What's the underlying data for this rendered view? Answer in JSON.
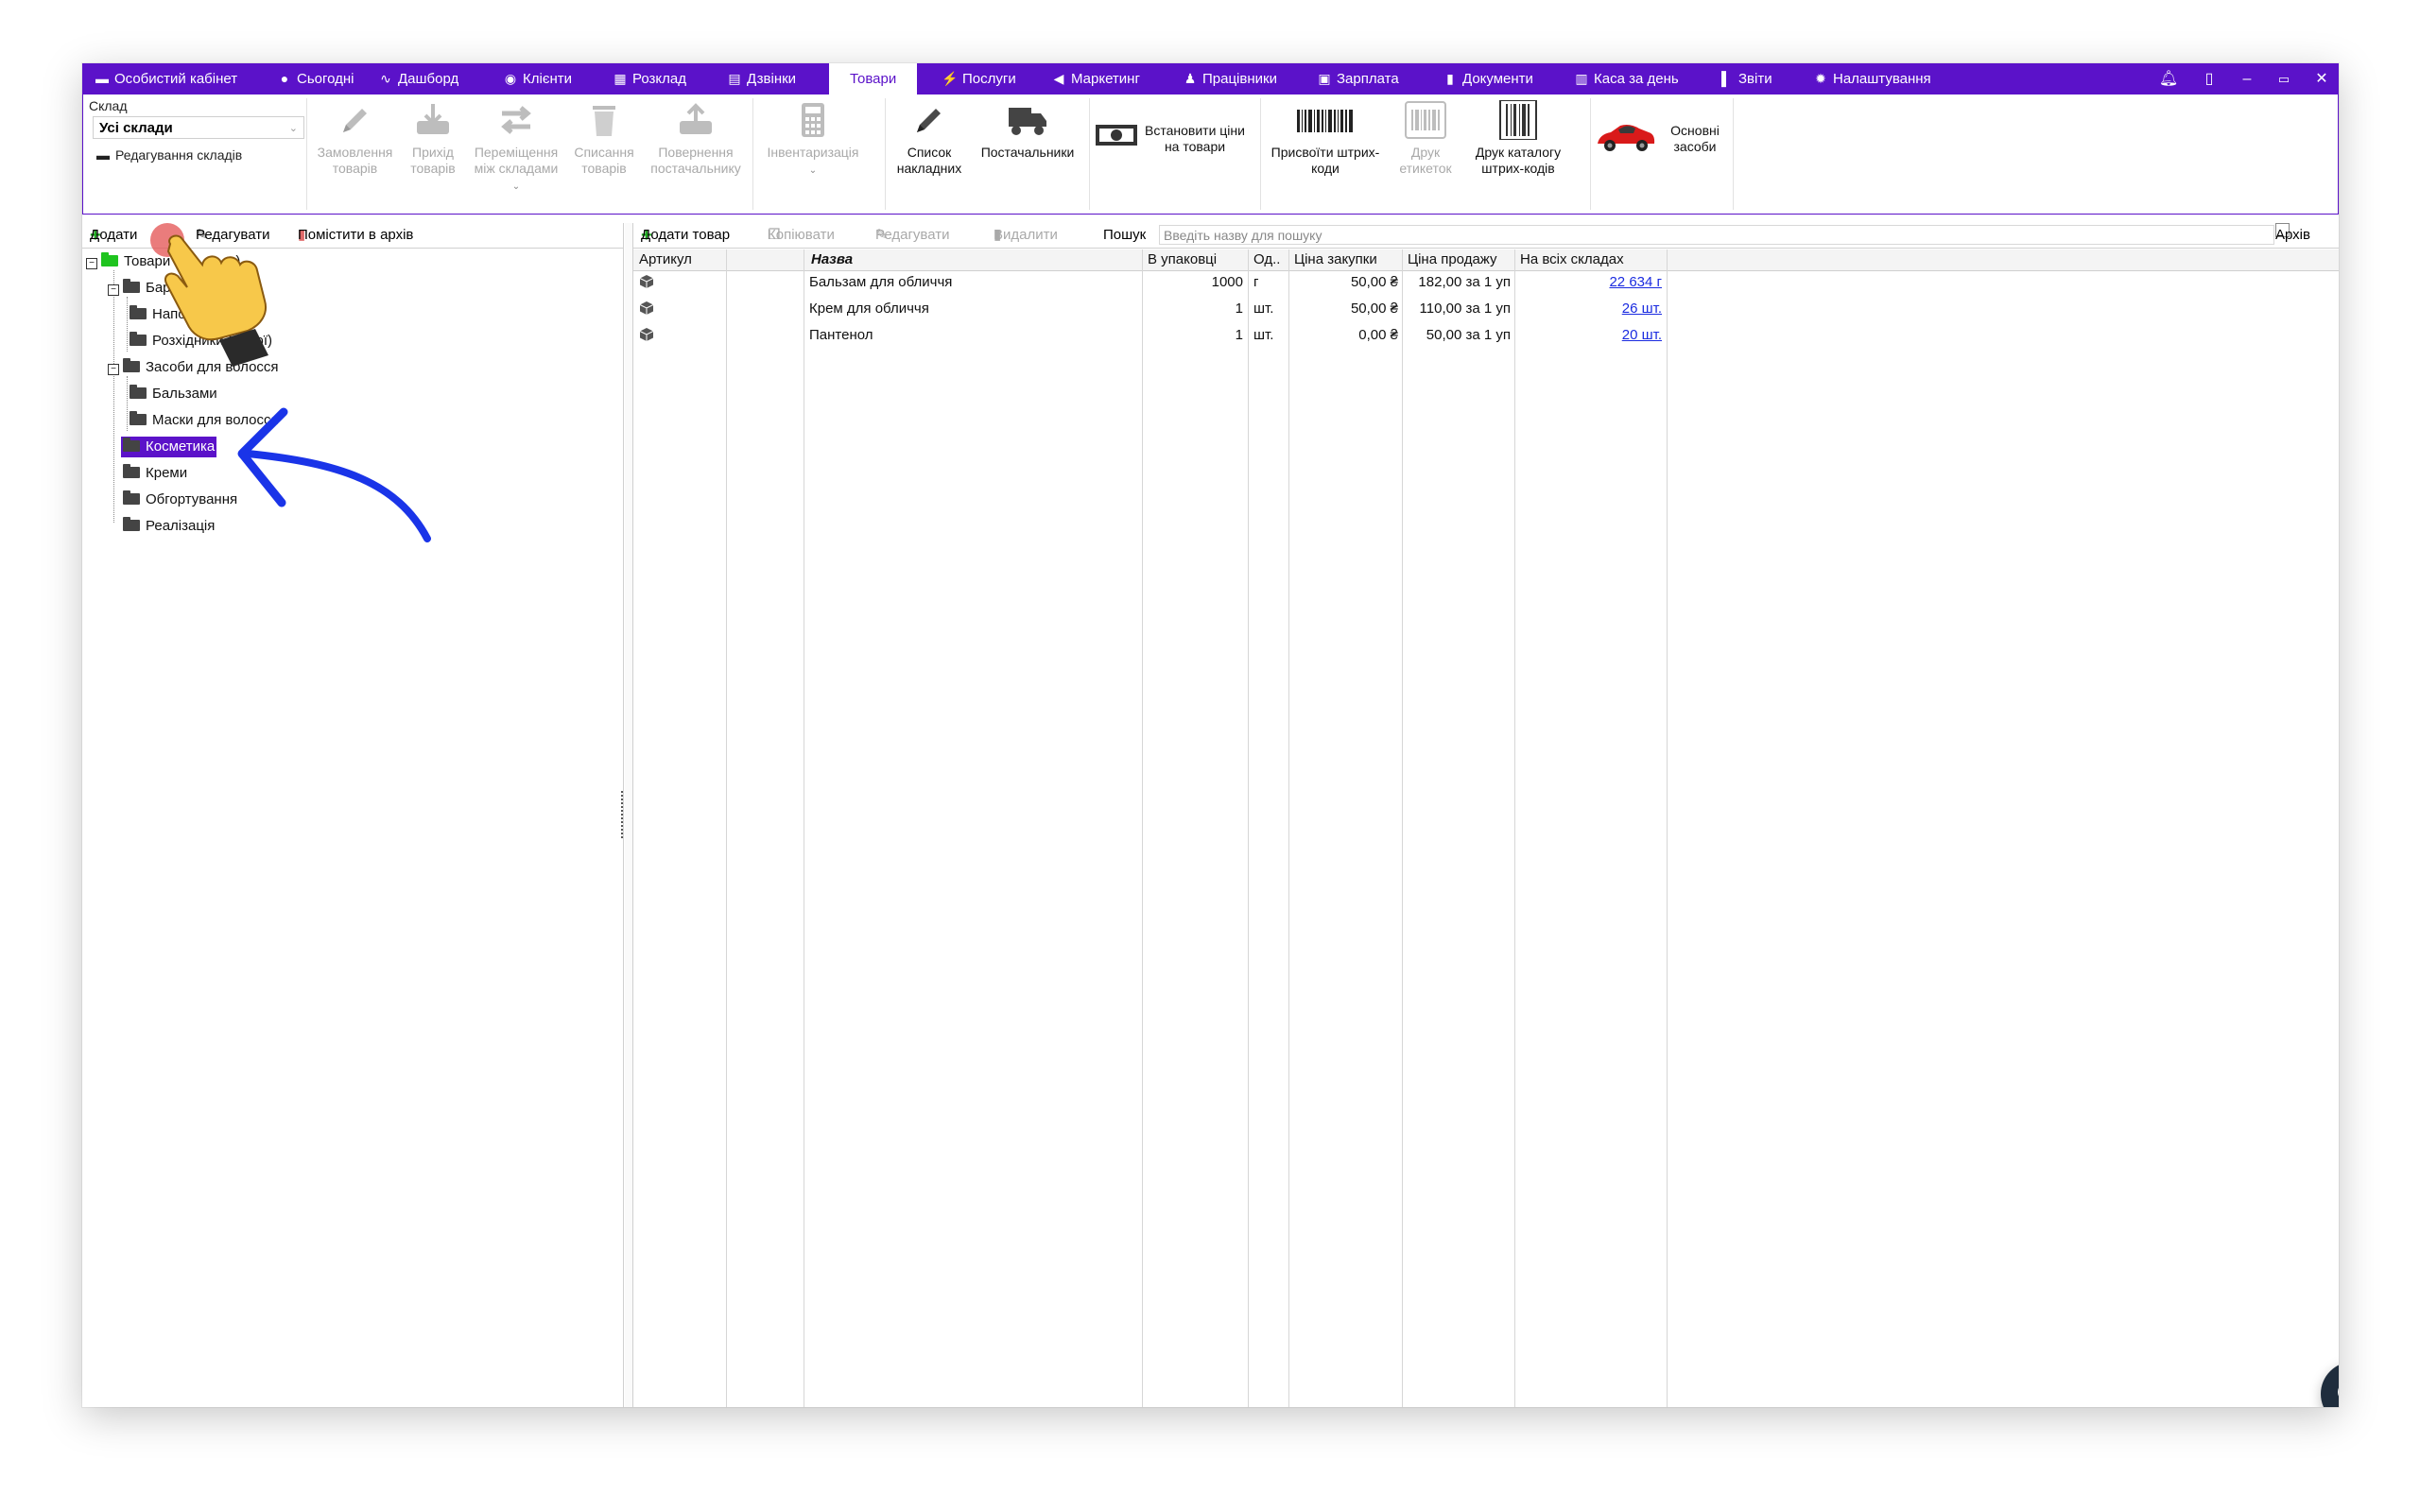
{
  "nav": {
    "items": [
      {
        "label": "Особистий кабінет",
        "icon": "briefcase-icon"
      },
      {
        "label": "Сьогодні",
        "icon": "clock-icon"
      },
      {
        "label": "Дашборд",
        "icon": "pulse-icon"
      },
      {
        "label": "Клієнти",
        "icon": "user-circle-icon"
      },
      {
        "label": "Розклад",
        "icon": "calendar-icon"
      },
      {
        "label": "Дзвінки",
        "icon": "phone-book-icon"
      },
      {
        "label": "Товари",
        "icon": ""
      },
      {
        "label": "Послуги",
        "icon": "lightning-icon"
      },
      {
        "label": "Маркетинг",
        "icon": "megaphone-icon"
      },
      {
        "label": "Працівники",
        "icon": "person-icon"
      },
      {
        "label": "Зарплата",
        "icon": "money-icon"
      },
      {
        "label": "Документи",
        "icon": "document-icon"
      },
      {
        "label": "Каса за день",
        "icon": "calculator-icon"
      },
      {
        "label": "Звіти",
        "icon": "bar-chart-icon"
      },
      {
        "label": "Налаштування",
        "icon": "gear-icon"
      }
    ],
    "active": "Товари",
    "right_icons": [
      "bell-icon",
      "lock-icon",
      "minimize-icon",
      "restore-icon",
      "close-icon"
    ]
  },
  "ribbon": {
    "warehouse_label": "Склад",
    "warehouse_value": "Усі склади",
    "edit_warehouses": "Редагування складів",
    "buttons": {
      "order": "Замовлення товарів",
      "receipt": "Прихід товарів",
      "transfer": "Переміщення між складами",
      "writeoff": "Списання товарів",
      "return": "Повернення постачальнику",
      "inventory": "Інвентаризація",
      "invoices": "Список накладних",
      "suppliers": "Постачальники",
      "set_prices": "Встановити ціни на товари",
      "assign_barcodes": "Присвоїти штрих-коди",
      "print_labels": "Друк етикеток",
      "print_catalog": "Друк каталогу штрих-кодів",
      "fixed_assets": "Основні засоби"
    }
  },
  "left_toolbar": {
    "add": "Додати",
    "edit": "Редагувати",
    "archive": "Помістити в архів"
  },
  "tree": {
    "root": "Товари (",
    "root_tail": ")",
    "items": [
      "Бар",
      "Напої",
      "Розхідники (напої)",
      "Засоби для волосся",
      "Бальзами",
      "Маски для волосся",
      "Косметика",
      "Креми",
      "Обгортування",
      "Реалізація"
    ]
  },
  "right_toolbar": {
    "add_product": "Додати товар",
    "copy": "Копіювати",
    "edit": "Редагувати",
    "delete": "Видалити",
    "search_label": "Пошук",
    "search_placeholder": "Введіть назву для пошуку",
    "archive": "Архів"
  },
  "table": {
    "headers": [
      "Артикул",
      "Назва",
      "В упаковці",
      "Од..",
      "Ціна закупки",
      "Ціна продажу",
      "На всіх складах"
    ],
    "rows": [
      {
        "name": "Бальзам для обличчя",
        "pack": "1000",
        "unit": "г",
        "purchase": "50,00 ₴",
        "sale": "182,00 за 1 уп",
        "stock": "22 634 г"
      },
      {
        "name": "Крем для обличчя",
        "pack": "1",
        "unit": "шт.",
        "purchase": "50,00 ₴",
        "sale": "110,00 за 1 уп",
        "stock": "26 шт."
      },
      {
        "name": "Пантенол",
        "pack": "1",
        "unit": "шт.",
        "purchase": "0,00 ₴",
        "sale": "50,00 за 1 уп",
        "stock": "20 шт."
      }
    ]
  },
  "colors": {
    "brand": "#5b12c9",
    "link": "#1a2be0",
    "annotation_arrow": "#1a34e8"
  }
}
